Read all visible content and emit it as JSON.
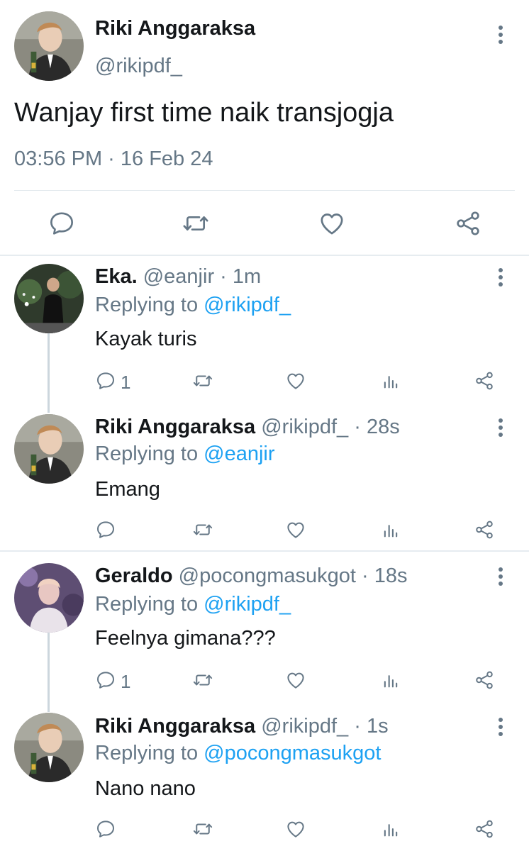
{
  "colors": {
    "text": "#14171a",
    "secondary": "#657786",
    "link": "#1da1f2",
    "divider": "#e6ecf0",
    "thread_line": "#ccd6dd"
  },
  "main_tweet": {
    "name": "Riki Anggaraksa",
    "handle": "@rikipdf_",
    "text": "Wanjay first time naik transjogja",
    "timestamp": "03:56 PM · 16 Feb 24",
    "actions": [
      "reply-icon",
      "retweet-icon",
      "like-icon",
      "share-icon"
    ]
  },
  "replies": [
    {
      "name": "Eka.",
      "meta": " @eanjir · 1m",
      "replying_label": "Replying to ",
      "replying_to": "@rikipdf_",
      "text": "Kayak turis",
      "reply_count": "1"
    },
    {
      "name": "Riki Anggaraksa",
      "meta": " @rikipdf_ · 28s",
      "replying_label": "Replying to ",
      "replying_to": "@eanjir",
      "text": "Emang",
      "reply_count": ""
    },
    {
      "name": "Geraldo",
      "meta": " @pocongmasukgot · 18s",
      "replying_label": "Replying to ",
      "replying_to": "@rikipdf_",
      "text": "Feelnya gimana???",
      "reply_count": "1"
    },
    {
      "name": "Riki Anggaraksa",
      "meta": " @rikipdf_ · 1s",
      "replying_label": "Replying to ",
      "replying_to": "@pocongmasukgot",
      "text": "Nano nano",
      "reply_count": ""
    }
  ]
}
